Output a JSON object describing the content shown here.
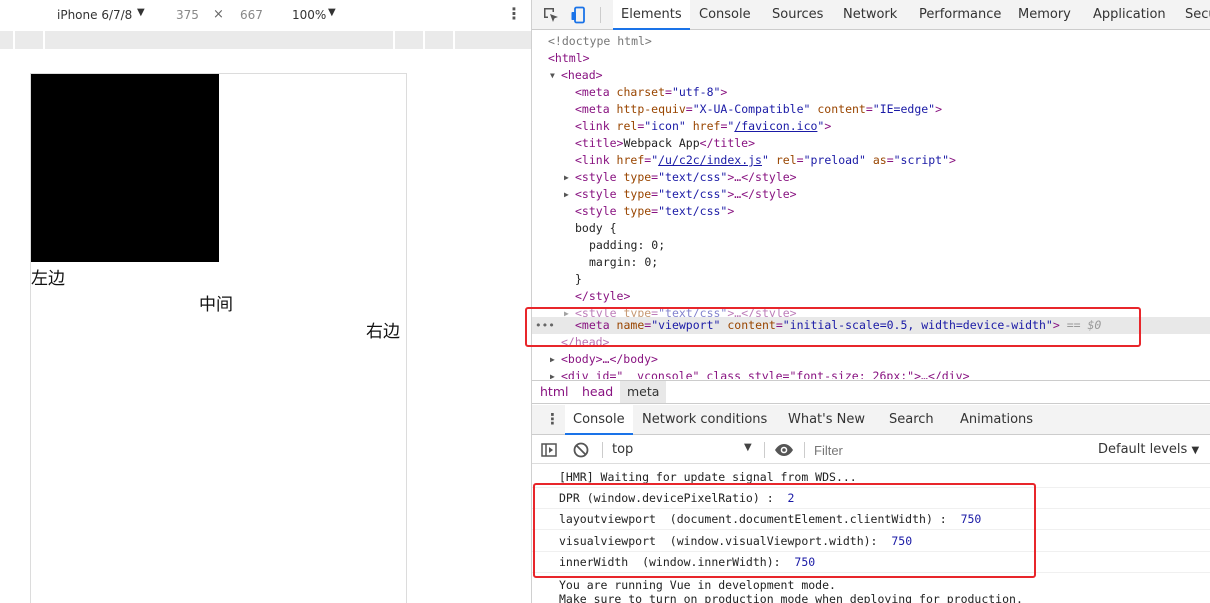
{
  "device_toolbar": {
    "device": "iPhone 6/7/8",
    "width": "375",
    "times": "×",
    "height": "667",
    "zoom": "100%"
  },
  "page": {
    "left_text": "左边",
    "middle_text": "中间",
    "right_text": "右边"
  },
  "devtools": {
    "tabs": [
      "Elements",
      "Console",
      "Sources",
      "Network",
      "Performance",
      "Memory",
      "Application",
      "Secu"
    ],
    "active_tab": "Elements",
    "dom": {
      "doctype": "<!doctype html>",
      "html_open": "<html>",
      "head_open": "<head>",
      "meta_charset_attr": "charset",
      "meta_charset_val": "\"utf-8\"",
      "meta_http_equiv_attr": "http-equiv",
      "meta_http_equiv_val": "\"X-UA-Compatible\"",
      "meta_content_attr": "content",
      "meta_content_val": "\"IE=edge\"",
      "link_rel_attr": "rel",
      "link_rel_val": "\"icon\"",
      "link_href_attr": "href",
      "link_href_val": "/favicon.ico",
      "title_text": "Webpack App",
      "preload_href": "/u/c2c/index.js",
      "preload_rel_val": "\"preload\"",
      "preload_as_attr": "as",
      "preload_as_val": "\"script\"",
      "style_type_attr": "type",
      "style_type_val": "\"text/css\"",
      "css_selector": "body {",
      "css_padding": "padding: 0;",
      "css_margin": "margin: 0;",
      "css_close": "}",
      "style_close": "</style>",
      "meta_name_attr": "name",
      "meta_name_val": "\"viewport\"",
      "meta_viewport_content_val": "\"initial-scale=0.5, width=device-width\"",
      "selected_marker": "== $0",
      "head_close": "</head>",
      "body_collapsed": "<body>…</body>",
      "vconsole_line": "<div id=\"__vconsole\" class style=\"font-size: 26px;\">…</div>"
    },
    "breadcrumbs": [
      "html",
      "head",
      "meta"
    ],
    "drawer_tabs": [
      "Console",
      "Network conditions",
      "What's New",
      "Search",
      "Animations"
    ],
    "console_toolbar": {
      "context": "top",
      "filter_placeholder": "Filter",
      "levels": "Default levels"
    },
    "console_messages": [
      {
        "text": "[HMR] Waiting for update signal from WDS...",
        "value": ""
      },
      {
        "text": "DPR (window.devicePixelRatio) :  ",
        "value": "2"
      },
      {
        "text": "layoutviewport  (document.documentElement.clientWidth) :  ",
        "value": "750"
      },
      {
        "text": "visualviewport  (window.visualViewport.width):  ",
        "value": "750"
      },
      {
        "text": "innerWidth  (window.innerWidth):  ",
        "value": "750"
      },
      {
        "text": "You are running Vue in development mode.",
        "value": ""
      },
      {
        "text": "Make sure to turn on production mode when deploying for production.",
        "value": ""
      }
    ]
  },
  "colors": {
    "highlight_box": "#e8262b",
    "active_tab_underline": "#1a73e8",
    "tag": "#881280",
    "attr_name": "#994500",
    "attr_value": "#1a1aa6"
  }
}
